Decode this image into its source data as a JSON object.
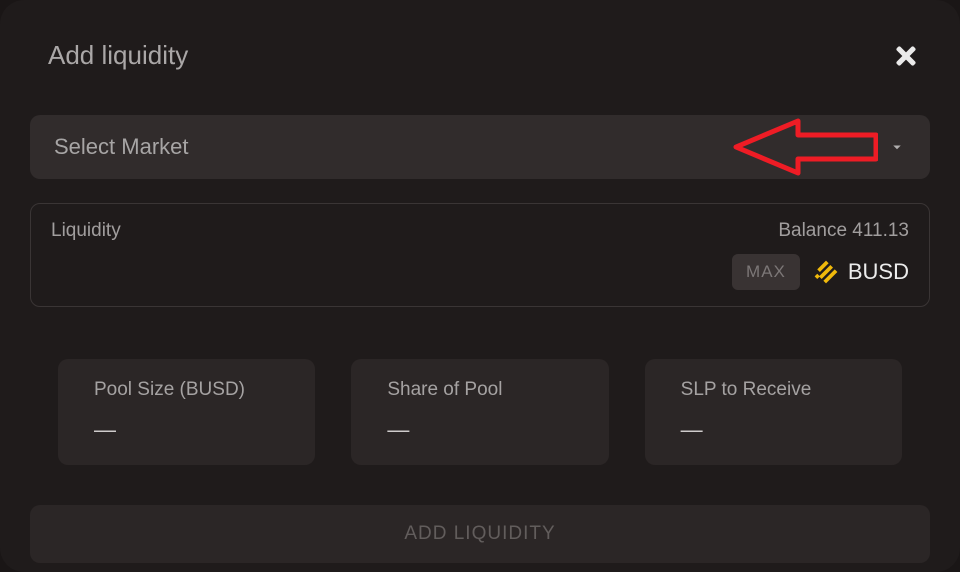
{
  "title": "Add liquidity",
  "select_market": {
    "label": "Select Market"
  },
  "liquidity": {
    "label": "Liquidity",
    "balance_label": "Balance 411.13",
    "max_label": "MAX",
    "token_symbol": "BUSD"
  },
  "stats": {
    "pool_size": {
      "label": "Pool Size (BUSD)",
      "value": "—"
    },
    "share": {
      "label": "Share of Pool",
      "value": "—"
    },
    "slp": {
      "label": "SLP to Receive",
      "value": "—"
    }
  },
  "submit_label": "ADD LIQUIDITY",
  "colors": {
    "busd_yellow": "#f0b90b",
    "annotation_red": "#ee1c25"
  }
}
